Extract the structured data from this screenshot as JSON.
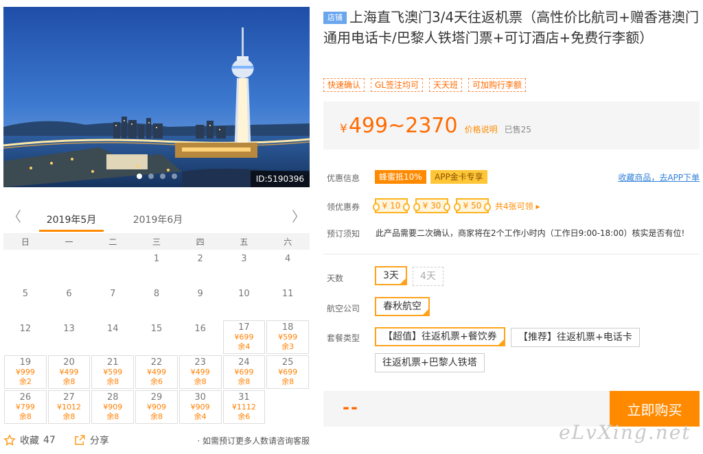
{
  "hero": {
    "id_label": "ID:5190396",
    "slides": 4,
    "active_slide": 0
  },
  "calendar": {
    "months": [
      "2019年5月",
      "2019年6月"
    ],
    "active_month": 0,
    "weekdays": [
      "日",
      "一",
      "二",
      "三",
      "四",
      "五",
      "六"
    ],
    "weeks": [
      [
        null,
        null,
        null,
        {
          "day": "1"
        },
        {
          "day": "2"
        },
        {
          "day": "3"
        },
        {
          "day": "4"
        }
      ],
      [
        {
          "day": "5"
        },
        {
          "day": "6"
        },
        {
          "day": "7"
        },
        {
          "day": "8"
        },
        {
          "day": "9"
        },
        {
          "day": "10"
        },
        {
          "day": "11"
        }
      ],
      [
        {
          "day": "12"
        },
        {
          "day": "13"
        },
        {
          "day": "14"
        },
        {
          "day": "15"
        },
        {
          "day": "16"
        },
        {
          "day": "17",
          "price": "¥699",
          "stock": "余4"
        },
        {
          "day": "18",
          "price": "¥599",
          "stock": "余3"
        }
      ],
      [
        {
          "day": "19",
          "price": "¥999",
          "stock": "余2"
        },
        {
          "day": "20",
          "price": "¥499",
          "stock": "余8"
        },
        {
          "day": "21",
          "price": "¥599",
          "stock": "余8"
        },
        {
          "day": "22",
          "price": "¥499",
          "stock": "余6"
        },
        {
          "day": "23",
          "price": "¥499",
          "stock": "余8"
        },
        {
          "day": "24",
          "price": "¥699",
          "stock": "余8"
        },
        {
          "day": "25",
          "price": "¥699",
          "stock": "余8"
        }
      ],
      [
        {
          "day": "26",
          "price": "¥799",
          "stock": "余8"
        },
        {
          "day": "27",
          "price": "¥1012",
          "stock": "余8"
        },
        {
          "day": "28",
          "price": "¥909",
          "stock": "余8"
        },
        {
          "day": "29",
          "price": "¥909",
          "stock": "余8"
        },
        {
          "day": "30",
          "price": "¥909",
          "stock": "余4"
        },
        {
          "day": "31",
          "price": "¥1112",
          "stock": "余6"
        },
        null
      ]
    ]
  },
  "share_bar": {
    "favorite_label": "收藏",
    "favorite_count": "47",
    "share_label": "分享",
    "note": "· 如需预订更多人数请咨询客服"
  },
  "product": {
    "store_badge": "店铺",
    "title": "上海直飞澳门3/4天往返机票（高性价比航司+赠香港澳门通用电话卡/巴黎人铁塔门票+可订酒店+免费行李额）",
    "tags": [
      "快速确认",
      "GL签注均可",
      "天天班",
      "可加购行李额"
    ],
    "price_currency": "¥",
    "price_range": "499~2370",
    "price_note": "价格说明",
    "sold": "已售25"
  },
  "info": {
    "promo_label": "优惠信息",
    "promo_badges": [
      "蜂蜜抵10%",
      "APP金卡专享"
    ],
    "fav_link": "收藏商品，去APP下单",
    "coupon_label": "领优惠券",
    "coupons": [
      "¥ 10",
      "¥ 30",
      "¥ 50"
    ],
    "coupon_more": "共4张可领 ▸",
    "booking_label": "预订须知",
    "booking_text": "此产品需要二次确认，商家将在2个工作小时内（工作日9:00-18:00）核实是否有位!"
  },
  "options": {
    "days_label": "天数",
    "days": [
      "3天",
      "4天"
    ],
    "airline_label": "航空公司",
    "airline": "春秋航空",
    "package_label": "套餐类型",
    "packages": [
      "【超值】往返机票+餐饮券",
      "【推荐】往返机票+电话卡",
      "往返机票+巴黎人铁塔"
    ]
  },
  "buy": {
    "price": "--",
    "button": "立即购买"
  },
  "watermark": "eLvXing.net",
  "colors": {
    "accent": "#ff8a00",
    "price": "#ff6a00",
    "link": "#2d7fd8",
    "store_badge": "#6aa6ee"
  }
}
